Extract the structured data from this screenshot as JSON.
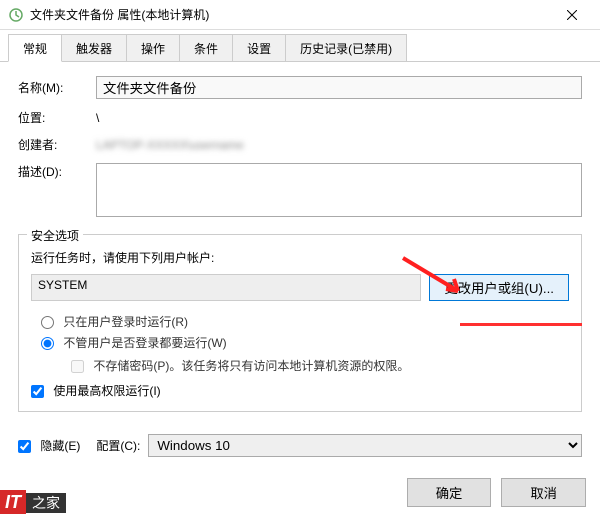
{
  "window": {
    "title": "文件夹文件备份 属性(本地计算机)"
  },
  "tabs": {
    "general": "常规",
    "triggers": "触发器",
    "actions": "操作",
    "conditions": "条件",
    "settings": "设置",
    "history": "历史记录(已禁用)"
  },
  "fields": {
    "name_label": "名称(M):",
    "name_value": "文件夹文件备份",
    "location_label": "位置:",
    "location_value": "\\",
    "creator_label": "创建者:",
    "creator_value": "LAPTOP-XXXXX\\username",
    "desc_label": "描述(D):"
  },
  "security": {
    "legend": "安全选项",
    "prompt": "运行任务时，请使用下列用户帐户:",
    "user": "SYSTEM",
    "change_btn": "更改用户或组(U)...",
    "radio1": "只在用户登录时运行(R)",
    "radio2": "不管用户是否登录都要运行(W)",
    "nopw": "不存储密码(P)。该任务将只有访问本地计算机资源的权限。",
    "highest": "使用最高权限运行(I)"
  },
  "bottom": {
    "hidden": "隐藏(E)",
    "config_label": "配置(C):",
    "config_value": "Windows 10"
  },
  "buttons": {
    "ok": "确定",
    "cancel": "取消"
  },
  "watermark": {
    "text1": "IT",
    "text2": "之家"
  }
}
